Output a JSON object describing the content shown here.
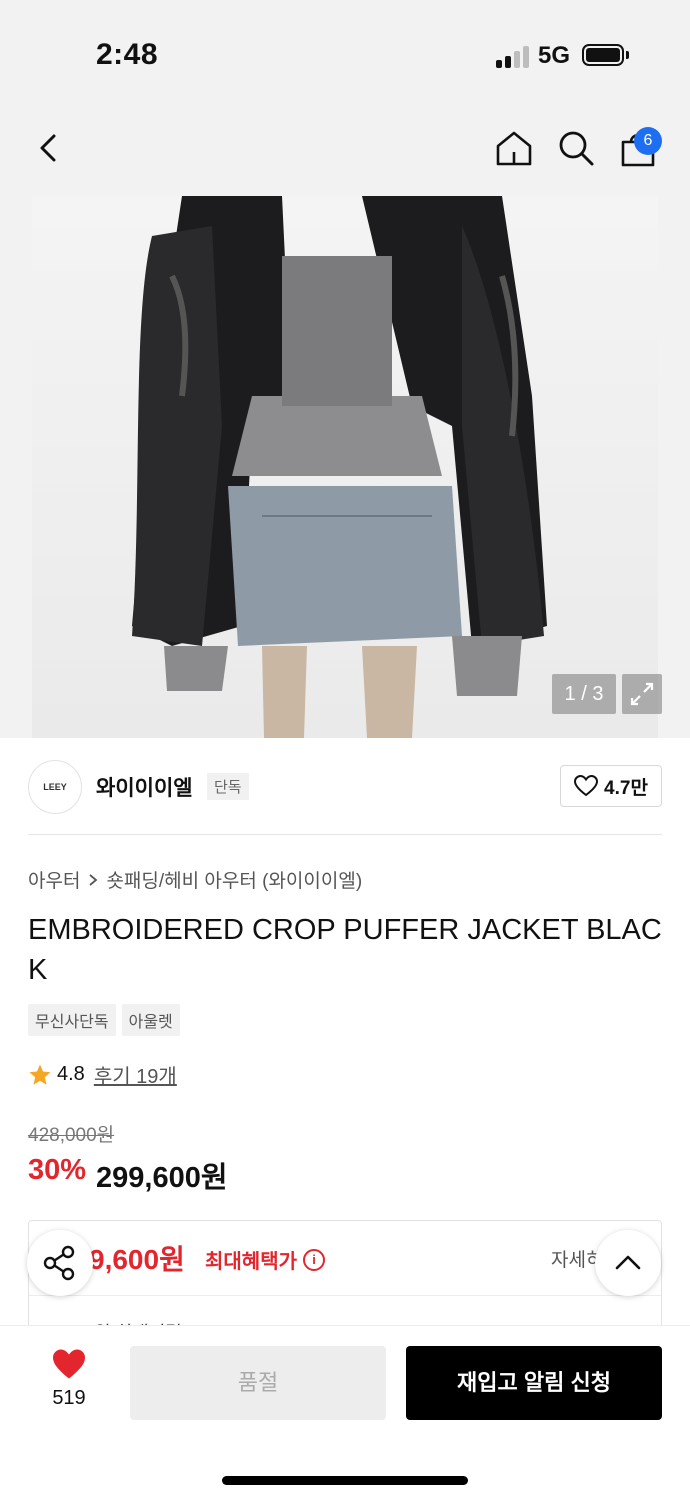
{
  "status_bar": {
    "time": "2:48",
    "network": "5G"
  },
  "header": {
    "cart_count": "6"
  },
  "gallery": {
    "counter": "1 / 3"
  },
  "brand": {
    "logo_text": "LEEY",
    "name": "와이이이엘",
    "badge": "단독",
    "likes": "4.7만"
  },
  "breadcrumb": {
    "category": "아우터",
    "subcategory": "숏패딩/헤비 아우터 (와이이이엘)"
  },
  "product": {
    "title": "EMBROIDERED CROP PUFFER JACKET BLACK",
    "tags": [
      "무신사단독",
      "아울렛"
    ],
    "rating": "4.8",
    "reviews": "후기 19개",
    "original_price": "428,000원",
    "discount": "30%",
    "sale_price": "299,600원"
  },
  "benefit": {
    "price": "9,600원",
    "label": "최대혜택가",
    "detail": "자세히",
    "sub": "2,500원 최대적립"
  },
  "bottom_bar": {
    "wish_count": "519",
    "soldout_label": "품절",
    "restock_label": "재입고 알림 신청"
  },
  "colors": {
    "accent_red": "#e3262d",
    "badge_blue": "#1e6ef2"
  }
}
